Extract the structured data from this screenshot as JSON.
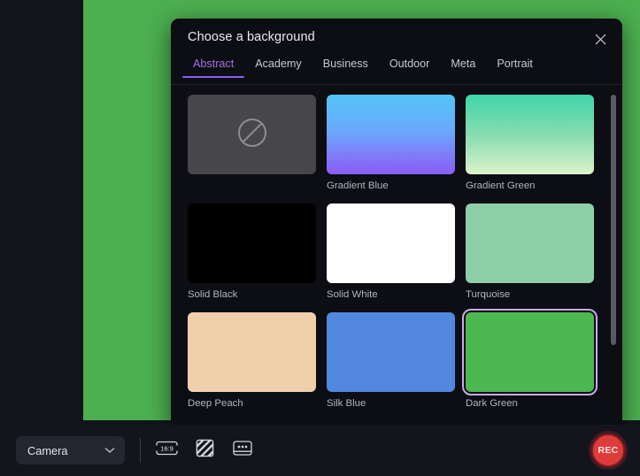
{
  "app": {
    "video_background_color": "#4caf50"
  },
  "modal": {
    "title": "Choose a background",
    "close_icon": "close-icon",
    "tabs": [
      {
        "label": "Abstract",
        "active": true
      },
      {
        "label": "Academy",
        "active": false
      },
      {
        "label": "Business",
        "active": false
      },
      {
        "label": "Outdoor",
        "active": false
      },
      {
        "label": "Meta",
        "active": false
      },
      {
        "label": "Portrait",
        "active": false
      }
    ],
    "active_tab_color": "#8b5cf6",
    "selection_border_color": "#c9a9e8",
    "backgrounds": [
      {
        "label": "",
        "kind": "none",
        "icon": "no-background-icon",
        "color": "#47474b"
      },
      {
        "label": "Gradient Blue",
        "kind": "gradient",
        "color_from": "#53c6f8",
        "color_to": "#8b5cf6"
      },
      {
        "label": "Gradient Green",
        "kind": "gradient",
        "color_from": "#3fd6a8",
        "color_to": "#ddf3c9"
      },
      {
        "label": "Solid Black",
        "kind": "solid",
        "color": "#000000"
      },
      {
        "label": "Solid White",
        "kind": "solid",
        "color": "#ffffff"
      },
      {
        "label": "Turquoise",
        "kind": "solid",
        "color": "#8ecfa8"
      },
      {
        "label": "Deep Peach",
        "kind": "solid",
        "color": "#f0d0aa"
      },
      {
        "label": "Silk Blue",
        "kind": "solid",
        "color": "#5287de"
      },
      {
        "label": "Dark Green",
        "kind": "solid",
        "color": "#4cb950",
        "selected": true
      }
    ]
  },
  "toolbar": {
    "camera_label": "Camera",
    "camera_chevron_icon": "chevron-down-icon",
    "aspect_ratio_label": "16:9",
    "tools": [
      {
        "name": "aspect-ratio-button",
        "icon": "aspect-ratio-icon"
      },
      {
        "name": "background-button",
        "icon": "diagonal-stripes-icon"
      },
      {
        "name": "captions-button",
        "icon": "captions-icon"
      }
    ],
    "record_label": "REC",
    "record_color": "#e03b3b"
  }
}
